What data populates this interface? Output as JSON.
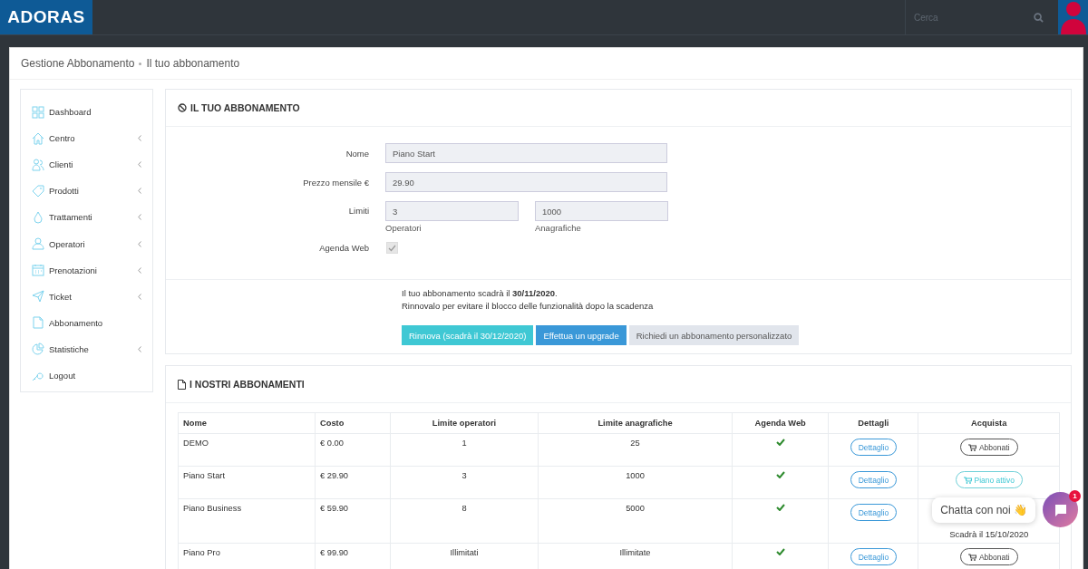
{
  "brand": "ADORAS",
  "search": {
    "placeholder": "Cerca"
  },
  "breadcrumb": [
    "Gestione Abbonamento",
    "Il tuo abbonamento"
  ],
  "sidebar": {
    "items": [
      {
        "label": "Dashboard",
        "submenu": false
      },
      {
        "label": "Centro",
        "submenu": true
      },
      {
        "label": "Clienti",
        "submenu": true
      },
      {
        "label": "Prodotti",
        "submenu": true
      },
      {
        "label": "Trattamenti",
        "submenu": true
      },
      {
        "label": "Operatori",
        "submenu": true
      },
      {
        "label": "Prenotazioni",
        "submenu": true
      },
      {
        "label": "Ticket",
        "submenu": true
      },
      {
        "label": "Abbonamento",
        "submenu": false
      },
      {
        "label": "Statistiche",
        "submenu": true
      },
      {
        "label": "Logout",
        "submenu": false
      }
    ]
  },
  "subscription": {
    "title": "IL TUO ABBONAMENTO",
    "name_label": "Nome",
    "name": "Piano Start",
    "price_label": "Prezzo mensile €",
    "price": "29.90",
    "limits_label": "Limiti",
    "operators": "3",
    "operators_label": "Operatori",
    "records": "1000",
    "records_label": "Anagrafiche",
    "agenda_label": "Agenda Web",
    "agenda_checked": true,
    "notice": "Il tuo abbonamento scadrà il **30/11/2020**.",
    "notice_2": "Rinnovalo per evitare il blocco delle funzionalità dopo la scadenza",
    "buttons": [
      {
        "label": "Rinnova (scadrà il 30/12/2020)",
        "kind": "renew"
      },
      {
        "label": "Effettua un upgrade",
        "kind": "upgrade"
      },
      {
        "label": "Richiedi un abbonamento personalizzato",
        "kind": "custom"
      }
    ]
  },
  "plans": {
    "title": "I NOSTRI ABBONAMENTI",
    "columns": [
      "Nome",
      "Costo",
      "Limite operatori",
      "Limite anagrafiche",
      "Agenda Web",
      "Dettagli",
      "Acquista"
    ],
    "rows": [
      {
        "name": "DEMO",
        "cost": "€ 0.00",
        "operators": "1",
        "records": "25",
        "agenda": true,
        "details": "Dettaglio",
        "buy": {
          "kind": "subscribe",
          "label": "Abbonati"
        }
      },
      {
        "name": "Piano Start",
        "cost": "€ 29.90",
        "operators": "3",
        "records": "1000",
        "agenda": true,
        "details": "Dettaglio",
        "buy": {
          "kind": "active",
          "label": "Piano attivo"
        }
      },
      {
        "name": "Piano Business",
        "cost": "€ 59.90",
        "operators": "8",
        "records": "5000",
        "agenda": true,
        "details": "Dettaglio",
        "buy": {
          "expiry": "Scadrà il 15/10/2020"
        }
      },
      {
        "name": "Piano Pro",
        "cost": "€ 99.90",
        "operators": "Illimitati",
        "records": "Illimitate",
        "agenda": true,
        "details": "Dettaglio",
        "buy": {
          "kind": "subscribe",
          "label": "Abbonati"
        }
      }
    ]
  },
  "chat": {
    "label": "Chatta con noi 👋",
    "badge": "1"
  }
}
